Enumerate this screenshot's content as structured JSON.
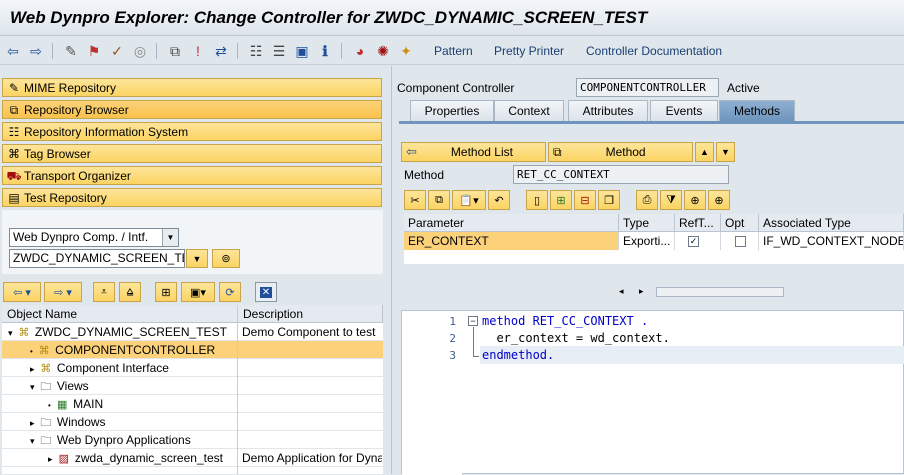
{
  "window": {
    "title": "Web Dynpro Explorer: Change Controller for ZWDC_DYNAMIC_SCREEN_TEST"
  },
  "toolbar": {
    "icons": [
      "back-arrow-icon",
      "forward-arrow-icon",
      "other-object-icon",
      "display-change-icon",
      "active-inactive-icon",
      "check-icon",
      "activate-icon",
      "where-used-icon",
      "navigation-window-icon",
      "object-list-icon",
      "display-object-list-icon",
      "info-icon",
      "test-icon",
      "web-dynpro-icon",
      "enhance-icon"
    ],
    "pattern_label": "Pattern",
    "pretty_printer_label": "Pretty Printer",
    "controller_doc_label": "Controller Documentation"
  },
  "nav": [
    {
      "label": "MIME Repository",
      "icon": "mime-icon"
    },
    {
      "label": "Repository Browser",
      "icon": "repository-browser-icon"
    },
    {
      "label": "Repository Information System",
      "icon": "info-system-icon"
    },
    {
      "label": "Tag Browser",
      "icon": "tag-browser-icon"
    },
    {
      "label": "Transport Organizer",
      "icon": "transport-icon"
    },
    {
      "label": "Test Repository",
      "icon": "test-repository-icon"
    }
  ],
  "browser": {
    "object_type": "Web Dynpro Comp. / Intf.",
    "object_name": "ZWDC_DYNAMIC_SCREEN_TEST"
  },
  "tree": {
    "columns": [
      "Object Name",
      "Description"
    ],
    "rows": [
      {
        "name": "ZWDC_DYNAMIC_SCREEN_TEST",
        "desc": "Demo Component to test"
      },
      {
        "name": "COMPONENTCONTROLLER",
        "desc": ""
      },
      {
        "name": "Component Interface",
        "desc": ""
      },
      {
        "name": "Views",
        "desc": ""
      },
      {
        "name": "MAIN",
        "desc": ""
      },
      {
        "name": "Windows",
        "desc": ""
      },
      {
        "name": "Web Dynpro Applications",
        "desc": ""
      },
      {
        "name": "zwda_dynamic_screen_test",
        "desc": "Demo Application for Dyna"
      }
    ]
  },
  "controller": {
    "label": "Component Controller",
    "name": "COMPONENTCONTROLLER",
    "status": "Active"
  },
  "tabs": [
    "Properties",
    "Context",
    "Attributes",
    "Events",
    "Methods"
  ],
  "methods": {
    "method_list_label": "Method List",
    "method_label": "Method",
    "method_field_label": "Method",
    "method_value": "RET_CC_CONTEXT",
    "columns": [
      "Parameter",
      "Type",
      "RefT...",
      "Opt",
      "Associated Type"
    ],
    "rows": [
      {
        "parameter": "ER_CONTEXT",
        "type": "Exporti...",
        "reft": "✓",
        "opt": "",
        "assoc": "IF_WD_CONTEXT_NODE"
      }
    ]
  },
  "editor": {
    "lines": [
      {
        "num": "1",
        "text": "method RET_CC_CONTEXT ."
      },
      {
        "num": "2",
        "text": "  er_context = wd_context."
      },
      {
        "num": "3",
        "text": "endmethod."
      }
    ]
  }
}
